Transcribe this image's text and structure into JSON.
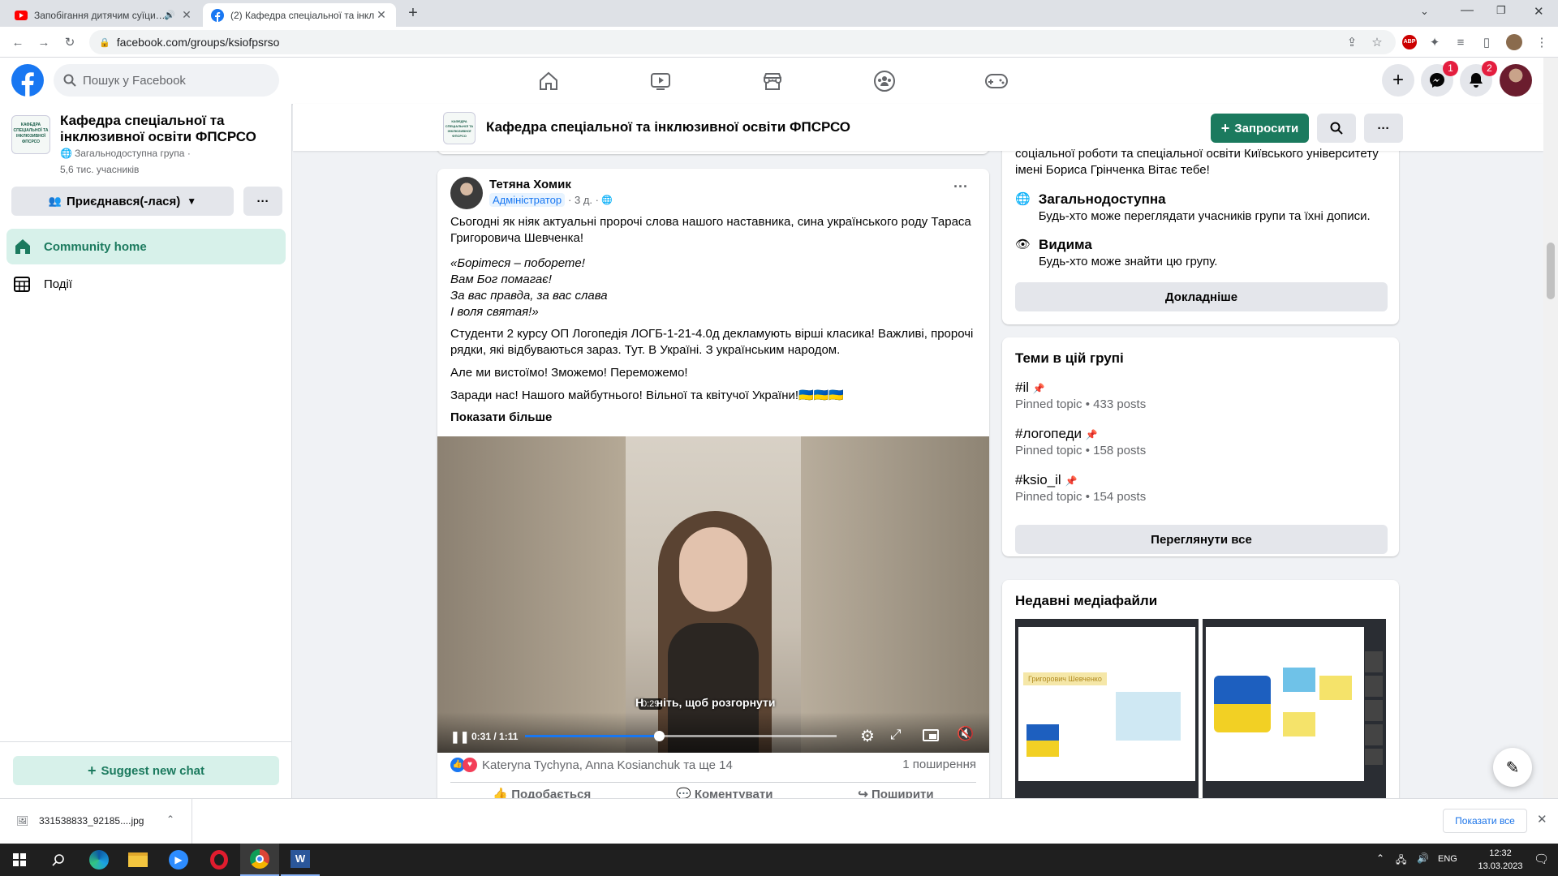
{
  "browser": {
    "tabs": [
      {
        "title": "Запобігання дитячим суїци…",
        "active": false
      },
      {
        "title": "(2) Кафедра спеціальної та інклю…",
        "active": true
      }
    ],
    "url": "facebook.com/groups/ksiofpsrso",
    "abp_label": "ABP"
  },
  "fb": {
    "search_placeholder": "Пошук у Facebook",
    "messenger_badge": "1",
    "notifications_badge": "2"
  },
  "group": {
    "logo_text": "КАФЕДРА СПЕЦІАЛЬНОЇ ТА ІНКЛЮЗИВНОЇ ФПСРСО",
    "name": "Кафедра спеціальної та інклюзивної освіти ФПСРСО",
    "privacy": "Загальнодоступна група ·",
    "members": "5,6 тис. учасників",
    "joined_label": "Приєднався(-лася)",
    "more_label": "···",
    "invite_label": "Запросити"
  },
  "sidebar": {
    "items": [
      {
        "label": "Community home",
        "active": true
      },
      {
        "label": "Події",
        "active": false
      }
    ],
    "suggest_chat": "Suggest new chat"
  },
  "post": {
    "author": "Тетяна Хомик",
    "role": "Адміністратор",
    "time": "· 3 д. ·",
    "p1": "Сьогодні як ніяк актуальні пророчі слова нашого наставника, сина українського роду Тараса Григоровича Шевченка!",
    "quote": [
      "«Борітеся – поборете!",
      "Вам Бог помагає!",
      "За вас правда, за вас слава",
      "І воля святая!»"
    ],
    "p2": "Студенти 2 курсу ОП Логопедія ЛОГБ-1-21-4.0д декламують вірші класика! Важливі, пророчі рядки, які відбуваються зараз. Тут. В Україні. З українським народом.",
    "p3": "Але ми вистоїмо! Зможемо! Переможемо!",
    "p4": "Заради нас! Нашого майбутнього! Вільної та квітучої України!🇺🇦🇺🇦🇺🇦",
    "show_more": "Показати більше",
    "video": {
      "current": "0:31 / 1:11",
      "hover_time": "0:29",
      "hint": "Н    ніть, щоб розгорнути",
      "progress": 0.43
    },
    "reactions": "Kateryna Tychyna, Anna Kosianchuk та ще 14",
    "shares": "1 поширення",
    "actions": [
      "Подобається",
      "Коментувати",
      "Поширити"
    ]
  },
  "about": {
    "intro": "соціальної роботи та спеціальної освіти Київського університету імені Бориса Грінченка Вітає тебе!",
    "public_title": "Загальнодоступна",
    "public_desc": "Будь-хто може переглядати учасників групи та їхні дописи.",
    "visible_title": "Видима",
    "visible_desc": "Будь-хто може знайти цю групу.",
    "details_btn": "Докладніше"
  },
  "topics": {
    "title": "Теми в цій групі",
    "items": [
      {
        "name": "#il",
        "meta": "Pinned topic • 433 posts"
      },
      {
        "name": "#логопеди",
        "meta": "Pinned topic • 158 posts"
      },
      {
        "name": "#ksio_il",
        "meta": "Pinned topic • 154 posts"
      }
    ],
    "see_all": "Переглянути все"
  },
  "media": {
    "title": "Недавні медіафайли",
    "thumb1_caption": "Григорович Шевченко"
  },
  "downloads": {
    "file": "331538833_92185....jpg",
    "show_all": "Показати все"
  },
  "taskbar": {
    "lang": "ENG",
    "time": "12:32",
    "date": "13.03.2023"
  },
  "colors": {
    "fb_blue": "#1877f2",
    "green": "#1b7a5e",
    "active_bg": "#d7f1ea"
  }
}
